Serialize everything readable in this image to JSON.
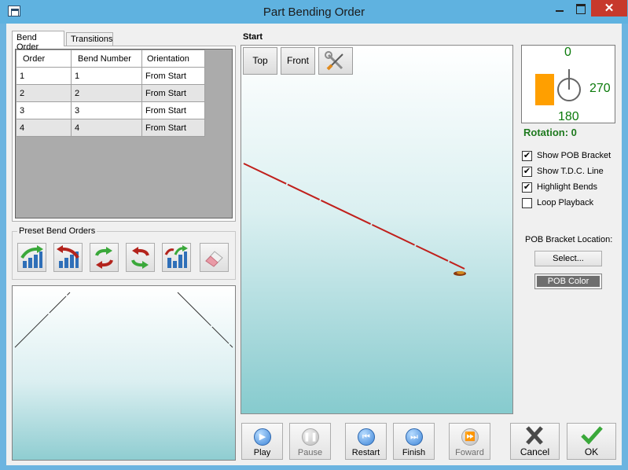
{
  "window": {
    "title": "Part Bending Order",
    "close_glyph": "✕"
  },
  "tabs": [
    {
      "label": "Bend Order",
      "active": true
    },
    {
      "label": "Transitions",
      "active": false
    }
  ],
  "bend_table": {
    "headers": [
      "Order",
      "Bend Number",
      "Orientation"
    ],
    "rows": [
      [
        "1",
        "1",
        "From Start"
      ],
      [
        "2",
        "2",
        "From Start"
      ],
      [
        "3",
        "3",
        "From Start"
      ],
      [
        "4",
        "4",
        "From Start"
      ]
    ]
  },
  "preset": {
    "label": "Preset Bend Orders",
    "buttons": [
      {
        "icon": "bars-ascending-green-arrow-icon"
      },
      {
        "icon": "bars-descending-red-arrow-icon"
      },
      {
        "icon": "swap-green-red-arrows-icon"
      },
      {
        "icon": "swap-red-green-arrows-icon"
      },
      {
        "icon": "bars-mixed-arrows-icon"
      },
      {
        "icon": "eraser-icon"
      }
    ]
  },
  "viewport": {
    "label": "Start",
    "top_button": "Top",
    "front_button": "Front",
    "tools_icon": "wrench-screwdriver-icon"
  },
  "gauge": {
    "top": "0",
    "right": "270",
    "bottom": "180",
    "rotation_text": "Rotation: 0"
  },
  "options": [
    {
      "label": "Show POB Bracket",
      "checked": true
    },
    {
      "label": "Show T.D.C. Line",
      "checked": true
    },
    {
      "label": "Highlight Bends",
      "checked": true
    },
    {
      "label": "Loop Playback",
      "checked": false
    }
  ],
  "pob": {
    "location_label": "POB Bracket Location:",
    "select_label": "Select...",
    "color_label": "POB Color",
    "color": "#6e6e6e"
  },
  "playback": {
    "play": "Play",
    "pause": "Pause",
    "restart": "Restart",
    "finish": "Finish",
    "forward": "Foward"
  },
  "actions": {
    "cancel": "Cancel",
    "ok": "OK"
  },
  "colors": {
    "accent_orange": "#ff9f00",
    "gauge_text": "#0b7a0b",
    "part_line": "#c0201c"
  }
}
